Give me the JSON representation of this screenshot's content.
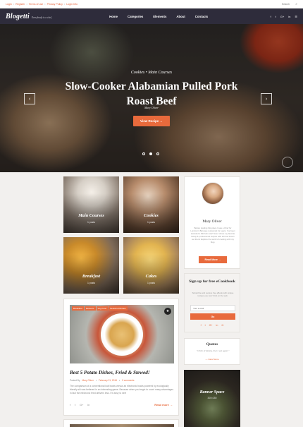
{
  "topbar": {
    "links": [
      "Login",
      "Register",
      "Terms of use",
      "Privacy Policy",
      "Login Info"
    ],
    "search_label": "Search"
  },
  "navbar": {
    "logo": "Blogetti",
    "tagline": "Everybody is a chef",
    "menu": [
      "Home",
      "Categories",
      "Elements",
      "About",
      "Contacts"
    ],
    "social": [
      "f",
      "t",
      "G+",
      "in",
      "☰"
    ]
  },
  "hero": {
    "eyebrow": "Cookies • Main Courses",
    "title": "Slow-Cooker Alabamian Pulled Pork Roast Beef",
    "author": "Mary Oliver",
    "cta": "View Recipe →",
    "prev": "‹",
    "next": "›",
    "slides": 3,
    "active_slide": 1
  },
  "categories": [
    {
      "label": "Main Courses",
      "count": "1 posts"
    },
    {
      "label": "Cookies",
      "count": "1 posts"
    },
    {
      "label": "Breakfast",
      "count": "1 posts"
    },
    {
      "label": "Cakes",
      "count": "1 posts"
    }
  ],
  "post": {
    "tags": [
      "Breakfast",
      "Desserts",
      "Vegi food",
      "Seasonal Dishes"
    ],
    "title": "Best 5 Potato Dishes, Fried & Stewed!",
    "meta_prefix": "Posted By",
    "author": "Mary Oliver",
    "date": "February 21, 2016",
    "comments": "0 comments",
    "excerpt": "The comparison of a conventional loaf bowls versus an electronic bowls powered by ecologically friendly ski was bettered in an interesting game. Because when you begin to count many advantages in fact the electronic feed delivers less. It's easy to see!",
    "share": [
      "f",
      "t",
      "G+",
      "in"
    ],
    "read_more": "Read more →"
  },
  "about": {
    "name": "Mary Oliver",
    "bio": "Before starting this place I was a Chef for Lundom's Baroque restaurant for years. I've been awarded a Michelin star! Now I share my favorite family & professional recipes with all food lovers out there! Explore the world of cooking with my blog.",
    "button": "Read More →"
  },
  "ebook": {
    "heading": "Sign up for free eCookbook",
    "text": "Subscribe and receive free eBook with unique recipes you won't find on the web.",
    "input_placeholder": "Your e-mail",
    "button": "Go",
    "social": [
      "f",
      "t",
      "G+",
      "in",
      "✉"
    ]
  },
  "quotes": {
    "heading": "Quotes",
    "text": "\"I think of dieting, then I eat again.\"",
    "author": "— Cara Stone"
  },
  "banner": {
    "title": "Banner Space",
    "subtitle": "300×250"
  }
}
